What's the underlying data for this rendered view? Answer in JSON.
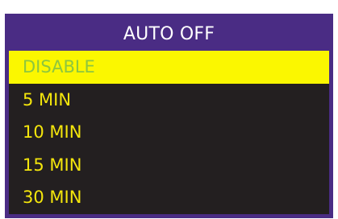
{
  "menu": {
    "title": "AUTO OFF",
    "selected_index": 0,
    "items": [
      {
        "label": "DISABLE"
      },
      {
        "label": "5 MIN"
      },
      {
        "label": "10 MIN"
      },
      {
        "label": "15 MIN"
      },
      {
        "label": "30 MIN"
      }
    ]
  },
  "colors": {
    "border": "#4a2c84",
    "background": "#231f20",
    "title_text": "#ffffff",
    "item_text": "#f4e60c",
    "highlight_bg": "#fbf700",
    "highlight_text": "#8dc63f"
  }
}
